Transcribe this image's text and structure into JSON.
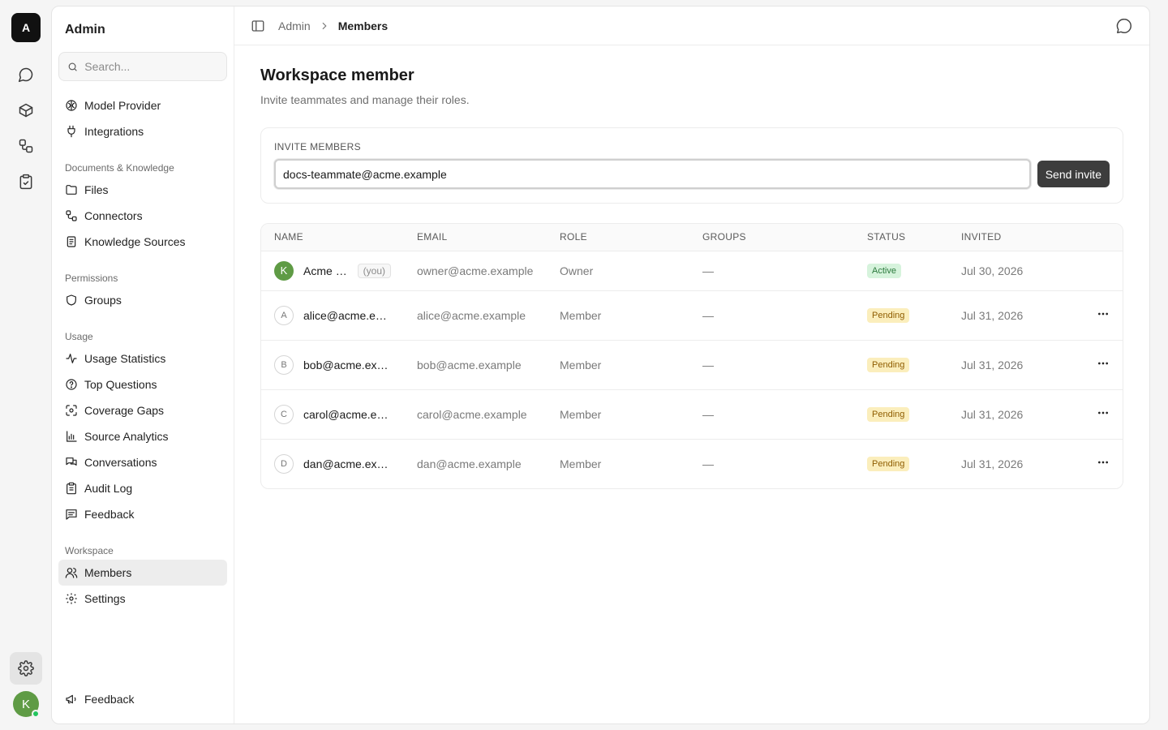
{
  "rail": {
    "logo": "A",
    "avatar": "K"
  },
  "sidebar": {
    "title": "Admin",
    "search_placeholder": "Search...",
    "top_items": [
      {
        "label": "Model Provider",
        "icon": "brain-icon"
      },
      {
        "label": "Integrations",
        "icon": "plug-icon"
      }
    ],
    "groups": [
      {
        "label": "Documents & Knowledge",
        "items": [
          "Files",
          "Connectors",
          "Knowledge Sources"
        ]
      },
      {
        "label": "Permissions",
        "items": [
          "Groups"
        ]
      },
      {
        "label": "Usage",
        "items": [
          "Usage Statistics",
          "Top Questions",
          "Coverage Gaps",
          "Source Analytics",
          "Conversations",
          "Audit Log",
          "Feedback"
        ]
      },
      {
        "label": "Workspace",
        "items": [
          "Members",
          "Settings"
        ]
      }
    ],
    "bottom_item": "Feedback"
  },
  "breadcrumb": {
    "parent": "Admin",
    "current": "Members"
  },
  "page": {
    "title": "Workspace member",
    "subtitle": "Invite teammates and manage their roles."
  },
  "invite": {
    "label": "INVITE MEMBERS",
    "value": "docs-teammate@acme.example",
    "button": "Send invite"
  },
  "table": {
    "headers": [
      "NAME",
      "EMAIL",
      "ROLE",
      "GROUPS",
      "STATUS",
      "INVITED"
    ],
    "you_tag": "(you)",
    "rows": [
      {
        "initial": "K",
        "name": "Acme Ow...",
        "email": "owner@acme.example",
        "role": "Owner",
        "groups": "—",
        "status": "Active",
        "invited": "Jul 30, 2026"
      },
      {
        "initial": "A",
        "name": "alice@acme.exa...",
        "email": "alice@acme.example",
        "role": "Member",
        "groups": "—",
        "status": "Pending",
        "invited": "Jul 31, 2026"
      },
      {
        "initial": "B",
        "name": "bob@acme.exam...",
        "email": "bob@acme.example",
        "role": "Member",
        "groups": "—",
        "status": "Pending",
        "invited": "Jul 31, 2026"
      },
      {
        "initial": "C",
        "name": "carol@acme.exa...",
        "email": "carol@acme.example",
        "role": "Member",
        "groups": "—",
        "status": "Pending",
        "invited": "Jul 31, 2026"
      },
      {
        "initial": "D",
        "name": "dan@acme.exam...",
        "email": "dan@acme.example",
        "role": "Member",
        "groups": "—",
        "status": "Pending",
        "invited": "Jul 31, 2026"
      }
    ]
  },
  "colors": {
    "owner_avatar": "#5f9b45",
    "active_badge_bg": "#d6f3dc",
    "pending_badge_bg": "#fbeebc",
    "send_button": "#3d3d3d"
  }
}
